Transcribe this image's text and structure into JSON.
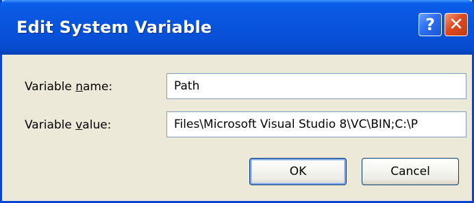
{
  "window": {
    "title": "Edit System Variable",
    "help_button_glyph": "?",
    "close_button_glyph": "✕"
  },
  "form": {
    "name_label_before": "Variable ",
    "name_label_mnemonic": "n",
    "name_label_after": "ame:",
    "name_value": "Path",
    "value_label_before": "Variable ",
    "value_label_mnemonic": "v",
    "value_label_after": "alue:",
    "value_value": "Files\\Microsoft Visual Studio 8\\VC\\BIN;C:\\P"
  },
  "buttons": {
    "ok_label": "OK",
    "cancel_label": "Cancel"
  },
  "colors": {
    "titlebar": "#0855dd",
    "dialog_background": "#ece9d8",
    "close_button": "#dd4a21",
    "help_button": "#2c6ff0"
  }
}
